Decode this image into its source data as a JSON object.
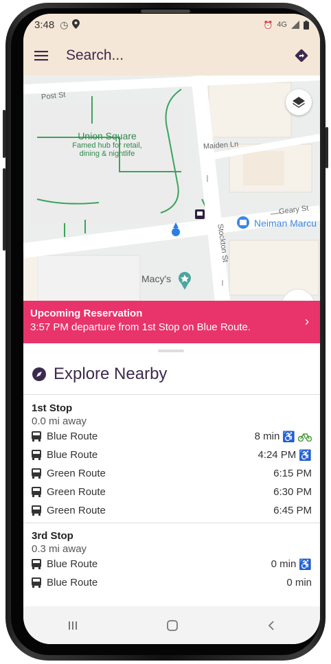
{
  "status": {
    "time": "3:48",
    "net_text": "4G"
  },
  "appbar": {
    "search_placeholder": "Search..."
  },
  "map": {
    "streets": {
      "post": "Post St",
      "maiden": "Maiden Ln",
      "geary": "Geary St",
      "stockton": "Stockton St"
    },
    "park": {
      "name": "Union Square",
      "desc1": "Famed hub for retail,",
      "desc2": "dining & nightlife"
    },
    "places": {
      "neiman": "Neiman Marcu",
      "macys": "Macy's"
    }
  },
  "reservation": {
    "title": "Upcoming Reservation",
    "detail": "3:57 PM departure from 1st Stop on Blue Route."
  },
  "explore": {
    "title": "Explore Nearby"
  },
  "stops": [
    {
      "name": "1st Stop",
      "distance": "0.0 mi away",
      "routes": [
        {
          "name": "Blue Route",
          "time": "8 min"
        },
        {
          "name": "Blue Route",
          "time": "4:24 PM"
        },
        {
          "name": "Green Route",
          "time": "6:15 PM"
        },
        {
          "name": "Green Route",
          "time": "6:30 PM"
        },
        {
          "name": "Green Route",
          "time": "6:45 PM"
        }
      ]
    },
    {
      "name": "3rd Stop",
      "distance": "0.3 mi away",
      "routes": [
        {
          "name": "Blue Route",
          "time": "0 min"
        },
        {
          "name": "Blue Route",
          "time": "0 min"
        }
      ]
    }
  ],
  "colors": {
    "accent": "#3c2a4e",
    "banner": "#e8346a",
    "appbar": "#f4e7d7",
    "park": "#2f8a4a",
    "accessible": "#4a9c3a"
  }
}
